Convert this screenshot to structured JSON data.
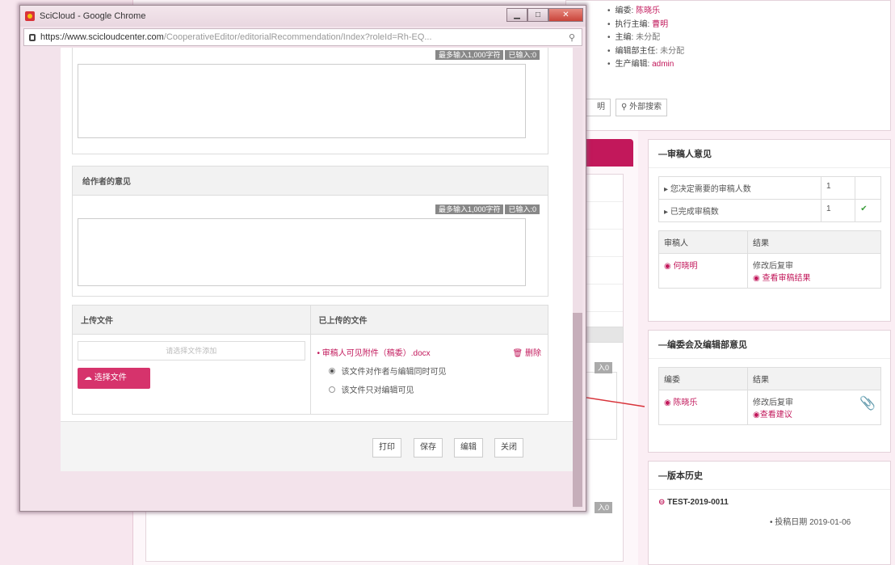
{
  "bg": {
    "meta": [
      {
        "label": "编委:",
        "value": "陈晓乐",
        "style": "pink"
      },
      {
        "label": "执行主编:",
        "value": "曹明",
        "style": "pink"
      },
      {
        "label": "主编:",
        "value": "未分配",
        "style": "gray"
      },
      {
        "label": "编辑部主任:",
        "value": "未分配",
        "style": "gray"
      },
      {
        "label": "生产编辑:",
        "value": "admin",
        "style": "pink"
      }
    ],
    "btn_partial": "明",
    "btn_search": "外部搜索",
    "badge1": "入0",
    "badge2": "入0"
  },
  "side": {
    "reviewer_title": "审稿人意见",
    "reviewer_rows": [
      {
        "label": "您决定需要的审稿人数",
        "count": "1"
      },
      {
        "label": "已完成审稿数",
        "count": "1"
      }
    ],
    "reviewer_head": [
      "审稿人",
      "结果"
    ],
    "reviewer_name": "何晓明",
    "reviewer_result": "修改后复审",
    "reviewer_link": "查看审稿结果",
    "editorial_title": "编委会及编辑部意见",
    "editorial_head": [
      "编委",
      "结果"
    ],
    "editor_name": "陈晓乐",
    "editor_result": "修改后复审",
    "editor_link": "查看建议",
    "history_title": "版本历史",
    "history_id": "TEST-2019-0011",
    "history_date_label": "投稿日期",
    "history_date": "2019-01-06"
  },
  "window": {
    "title": "SciCloud - Google Chrome",
    "url_main": "https://www.scicloudcenter.com",
    "url_rest": "/CooperativeEditor/editorialRecommendation/Index?roleId=Rh-EQ...",
    "min": "▁",
    "max": "□",
    "close": "✕"
  },
  "form": {
    "counter_label": "最多输入1,000字符",
    "counter_value": "已输入:0",
    "author_opinion": "给作者的意见",
    "upload_title": "上传文件",
    "uploaded_title": "已上传的文件",
    "file_placeholder": "请选择文件添加",
    "select_btn": "选择文件",
    "file_name": "审稿人可见附件（稿委）.docx",
    "delete": "删除",
    "radio1": "该文件对作者与编辑同时可见",
    "radio2": "该文件只对编辑可见",
    "buttons": [
      "打印",
      "保存",
      "编辑",
      "关闭"
    ]
  }
}
